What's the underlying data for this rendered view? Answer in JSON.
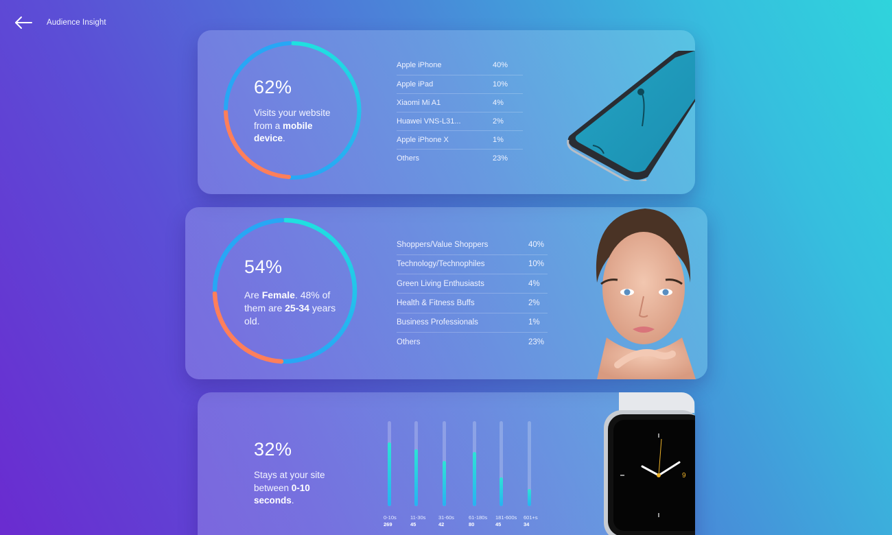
{
  "header": {
    "title": "Audience Insight",
    "back_icon": "arrow-left-icon"
  },
  "colors": {
    "ring_primary": "#1fd8e6",
    "ring_blue": "#27a7f5",
    "ring_orange": "#ff8a3d",
    "ring_pink": "#ff6f9c",
    "bar_fill": "#2de3d5"
  },
  "device_card": {
    "percent": "62%",
    "desc_prefix": "Visits your website from a ",
    "desc_bold": "mobile device",
    "desc_suffix": ".",
    "rows": [
      {
        "name": "Apple iPhone",
        "value": "40%"
      },
      {
        "name": "Apple iPad",
        "value": "10%"
      },
      {
        "name": "Xiaomi Mi A1",
        "value": "4%"
      },
      {
        "name": "Huawei VNS-L31...",
        "value": "2%"
      },
      {
        "name": "Apple iPhone X",
        "value": "1%"
      },
      {
        "name": "Others",
        "value": "23%"
      }
    ],
    "image": "smartphone-photo"
  },
  "demographic_card": {
    "percent": "54%",
    "desc_1": "Are ",
    "desc_bold_1": "Female",
    "desc_2": ". 48% of them are ",
    "desc_bold_2": "25-34",
    "desc_3": " years old.",
    "rows": [
      {
        "name": "Shoppers/Value Shoppers",
        "value": "40%"
      },
      {
        "name": "Technology/Technophiles",
        "value": "10%"
      },
      {
        "name": "Green Living Enthusiasts",
        "value": "4%"
      },
      {
        "name": "Health & Fitness Buffs",
        "value": "2%"
      },
      {
        "name": "Business Professionals",
        "value": "1%"
      },
      {
        "name": "Others",
        "value": "23%"
      }
    ],
    "image": "woman-portrait-photo"
  },
  "time_card": {
    "percent": "32%",
    "desc_prefix": "Stays at your site between ",
    "desc_bold": "0-10 seconds",
    "desc_suffix": ".",
    "image": "smartwatch-photo"
  },
  "chart_data": {
    "type": "bar",
    "categories": [
      "0-10s",
      "11-30s",
      "31-60s",
      "61-180s",
      "181-600s",
      "601+s"
    ],
    "values": [
      269,
      45,
      42,
      80,
      45,
      34
    ],
    "fill_fraction": [
      0.75,
      0.67,
      0.53,
      0.64,
      0.34,
      0.2
    ]
  }
}
